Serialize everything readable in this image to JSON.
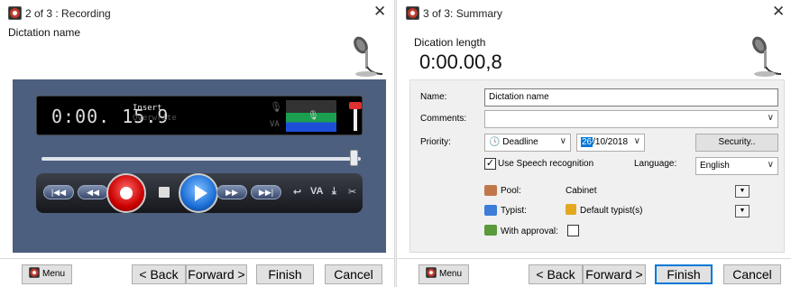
{
  "left": {
    "title": "2 of 3 : Recording",
    "subtitle": "Dictation name",
    "display": {
      "time": "0:00. 15.9",
      "mode_active": "Insert",
      "mode_inactive": "Overwrite",
      "va_label": "VA"
    },
    "position_fraction": 0.99,
    "transport": {
      "rewind_start": "|◀◀",
      "rewind": "◀◀",
      "forward": "▶▶",
      "forward_end": "▶▶|",
      "va_label": "VA"
    },
    "footer": {
      "menu": "Menu",
      "back": "< Back",
      "forward": "Forward >",
      "finish": "Finish",
      "cancel": "Cancel"
    }
  },
  "right": {
    "title": "3 of 3: Summary",
    "length_label": "Dication length",
    "length_value": "0:00.00,8",
    "form": {
      "name_label": "Name:",
      "name_value": "Dictation name",
      "comments_label": "Comments:",
      "comments_value": "",
      "priority_label": "Priority:",
      "priority_value": "Deadline",
      "date_day": "26",
      "date_rest": "/10/2018",
      "security_button": "Security..",
      "speech_label": "Use Speech recognition",
      "speech_checked": true,
      "language_label": "Language:",
      "language_value": "English",
      "pool_label": "Pool:",
      "pool_value": "Cabinet",
      "typist_label": "Typist:",
      "typist_value": "Default typist(s)",
      "approval_label": "With approval:",
      "approval_checked": false
    },
    "footer": {
      "menu": "Menu",
      "back": "< Back",
      "forward": "Forward >",
      "finish": "Finish",
      "cancel": "Cancel"
    }
  },
  "colors": {
    "recorder_bg": "#4d5f7e",
    "accent_blue": "#0078d7",
    "record_red": "#cc0000"
  }
}
